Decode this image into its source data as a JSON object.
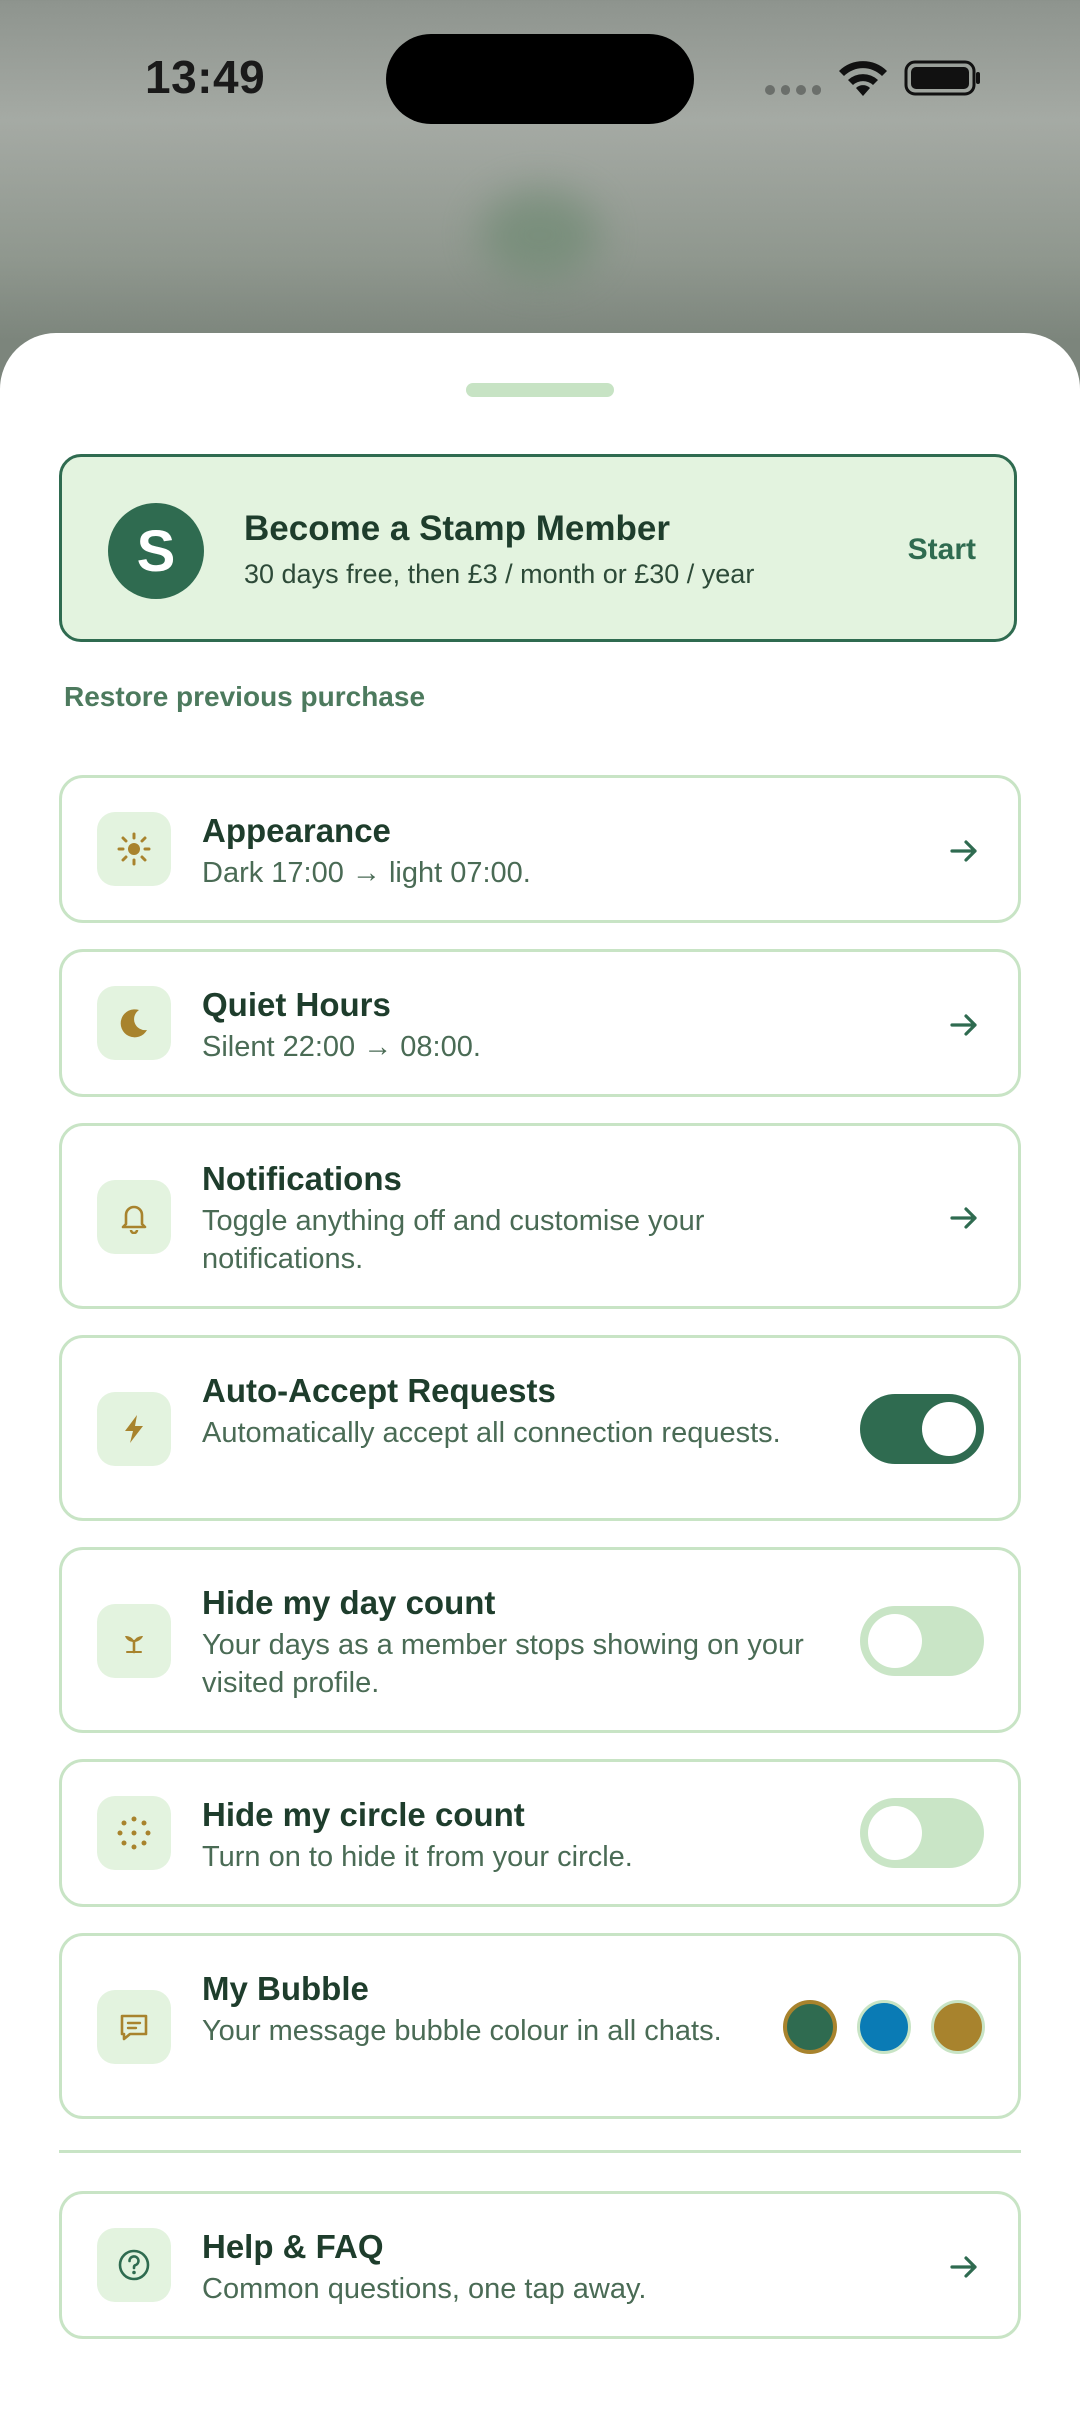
{
  "status": {
    "time": "13:49"
  },
  "member": {
    "logo_letter": "S",
    "title": "Become a Stamp Member",
    "subtitle": "30 days free, then £3 / month or £30 / year",
    "start_label": "Start"
  },
  "restore_label": "Restore previous purchase",
  "settings": [
    {
      "title": "Appearance",
      "subtitle": "Dark 17:00 → light 07:00.",
      "icon": "sun-icon",
      "control": "arrow"
    },
    {
      "title": "Quiet Hours",
      "subtitle": "Silent 22:00 → 08:00.",
      "icon": "moon-icon",
      "control": "arrow"
    },
    {
      "title": "Notifications",
      "subtitle": "Toggle anything off and customise your notifications.",
      "icon": "bell-icon",
      "control": "arrow"
    },
    {
      "title": "Auto-Accept Requests",
      "subtitle": "Automatically accept all connection requests.",
      "icon": "lightning-icon",
      "control": "toggle",
      "enabled": true
    },
    {
      "title": "Hide my day count",
      "subtitle": "Your days as a member stops showing on your visited profile.",
      "icon": "sprout-icon",
      "control": "toggle",
      "enabled": false
    },
    {
      "title": "Hide my circle count",
      "subtitle": "Turn on to hide it from your circle.",
      "icon": "dotted-circle-icon",
      "control": "toggle",
      "enabled": false
    },
    {
      "title": "My Bubble",
      "subtitle": "Your message bubble colour in all chats.",
      "icon": "chat-bubble-icon",
      "control": "swatches"
    }
  ],
  "bubble_colors": [
    {
      "name": "green",
      "hex": "#2f6b50",
      "selected": true
    },
    {
      "name": "blue",
      "hex": "#0a7bb5",
      "selected": false
    },
    {
      "name": "gold",
      "hex": "#a8832d",
      "selected": false
    }
  ],
  "help": {
    "title": "Help & FAQ",
    "subtitle": "Common questions, one tap away.",
    "icon": "question-circle-icon"
  },
  "colors": {
    "accent": "#2f6b50",
    "accent_light": "#e3f3df",
    "border": "#c8e4c5",
    "icon_gold": "#a8832d"
  }
}
